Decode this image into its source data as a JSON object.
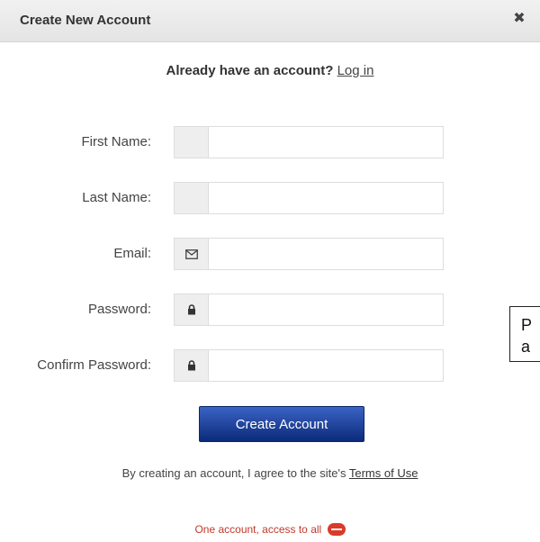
{
  "dialog": {
    "title": "Create New Account",
    "close_glyph": "✖"
  },
  "login_prompt": {
    "text": "Already have an account?",
    "link": "Log in"
  },
  "form": {
    "fields": [
      {
        "label": "First Name:",
        "icon": "",
        "value": ""
      },
      {
        "label": "Last Name:",
        "icon": "",
        "value": ""
      },
      {
        "label": "Email:",
        "icon": "envelope-icon",
        "value": ""
      },
      {
        "label": "Password:",
        "icon": "lock-icon",
        "value": ""
      },
      {
        "label": "Confirm Password:",
        "icon": "lock-icon",
        "value": ""
      }
    ],
    "submit_label": "Create Account"
  },
  "terms": {
    "text": "By creating an account, I agree to the site's",
    "link": "Terms of Use"
  },
  "tagline": {
    "text": "One account, access to all"
  },
  "callout": {
    "line1": "P",
    "line2": "a"
  },
  "colors": {
    "button": "#1c3f99",
    "tagline": "#c0392b",
    "titlebar": "#e8e8e8"
  }
}
